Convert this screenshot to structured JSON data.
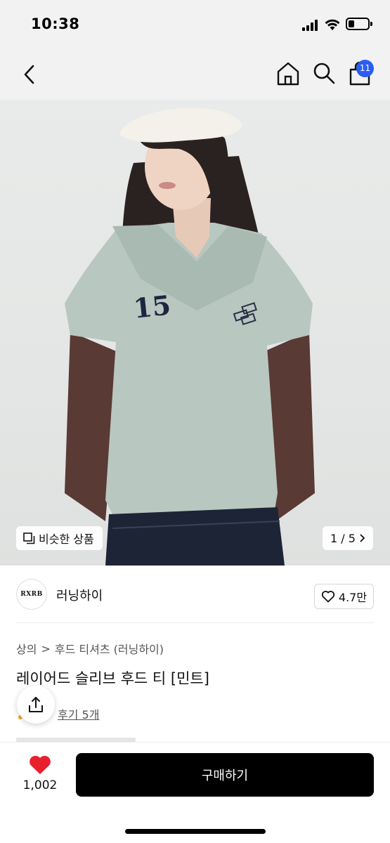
{
  "status_bar": {
    "time": "10:38"
  },
  "nav": {
    "cart_count": "11"
  },
  "gallery": {
    "similar_label": "비슷한 상품",
    "page_indicator": "1 / 5",
    "jersey_number": "15"
  },
  "brand": {
    "logo_text": "RXRB",
    "name": "러닝하이",
    "like_count": "4.7만"
  },
  "breadcrumb": {
    "category": "상의",
    "separator": ">",
    "subcategory": "후드 티셔츠 (러닝하이)"
  },
  "product": {
    "title": "레이어드 슬리브 후드 티 [민트]",
    "review_link": "후기 5개"
  },
  "bottom_bar": {
    "wish_count": "1,002",
    "buy_label": "구매하기"
  },
  "colors": {
    "accent": "#2b5ef0",
    "heart": "#e8202e",
    "buy_button": "#000000",
    "shirt": "#b8c7c0"
  }
}
